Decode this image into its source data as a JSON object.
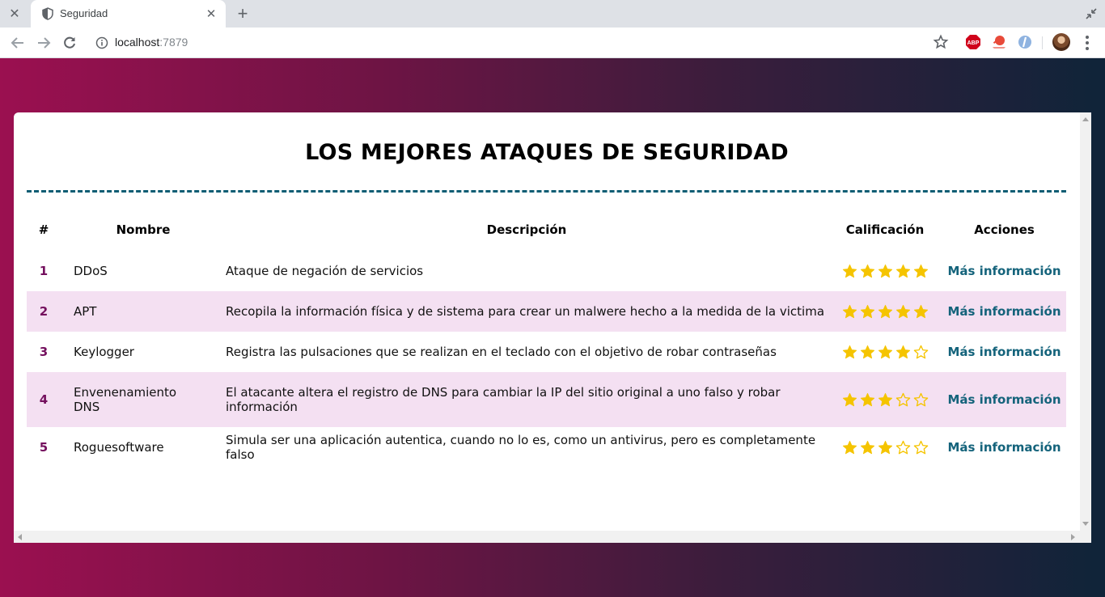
{
  "browser": {
    "tab_title": "Seguridad",
    "url_host": "localhost",
    "url_port": ":7879",
    "extensions": [
      "adblock-icon",
      "lastpass-icon",
      "extension-icon"
    ]
  },
  "page": {
    "title": "LOS MEJORES ATAQUES DE SEGURIDAD",
    "accent_color": "#0f5d74",
    "highlight_row_color": "#f4e0f2"
  },
  "table": {
    "headers": {
      "num": "#",
      "name": "Nombre",
      "description": "Descripción",
      "rating": "Calificación",
      "actions": "Acciones"
    },
    "rows": [
      {
        "num": "1",
        "name": "DDoS",
        "description": "Ataque de negación de servicios",
        "rating": 5,
        "action": "Más información"
      },
      {
        "num": "2",
        "name": "APT",
        "description": "Recopila la información física y de sistema para crear un malwere hecho a la medida de la victima",
        "rating": 5,
        "action": "Más información"
      },
      {
        "num": "3",
        "name": "Keylogger",
        "description": "Registra las pulsaciones que se realizan en el teclado con el objetivo de robar contraseñas",
        "rating": 4,
        "action": "Más información"
      },
      {
        "num": "4",
        "name": "Envenenamiento DNS",
        "description": "El atacante altera el registro de DNS para cambiar la IP del sitio original a uno falso y robar información",
        "rating": 3,
        "action": "Más información"
      },
      {
        "num": "5",
        "name": "Roguesoftware",
        "description": "Simula ser una aplicación autentica, cuando no lo es, como un antivirus, pero es completamente falso",
        "rating": 3,
        "action": "Más información"
      }
    ],
    "max_rating": 5,
    "star_color": "#f5c400"
  }
}
